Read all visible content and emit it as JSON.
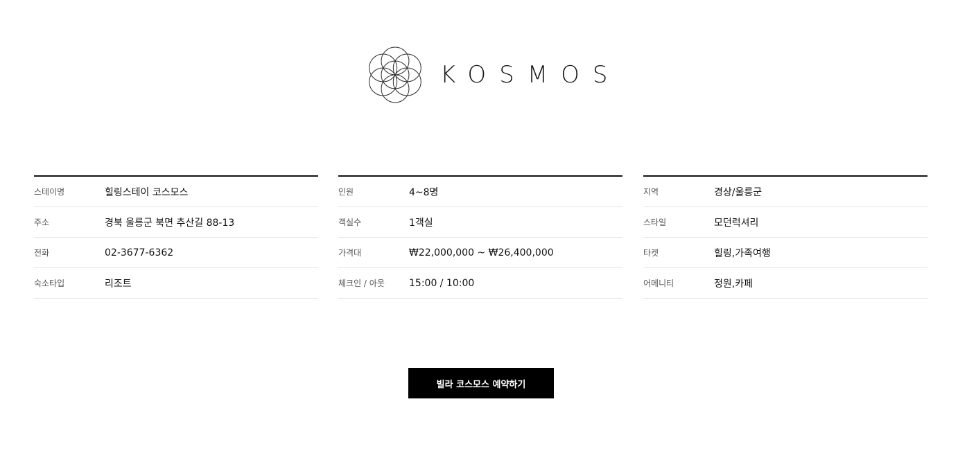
{
  "brand": {
    "logo_icon": "flower-of-life-icon",
    "name": "KOSMOS"
  },
  "info_columns": [
    {
      "rows": [
        {
          "label": "스테이명",
          "value": "힐링스테이 코스모스"
        },
        {
          "label": "주소",
          "value": "경북 울릉군 북면 추산길 88-13"
        },
        {
          "label": "전화",
          "value": "02-3677-6362"
        },
        {
          "label": "숙소타입",
          "value": "리조트"
        }
      ]
    },
    {
      "rows": [
        {
          "label": "인원",
          "value": "4~8명"
        },
        {
          "label": "객실수",
          "value": "1객실"
        },
        {
          "label": "가격대",
          "value": "₩22,000,000 ~ ₩26,400,000"
        },
        {
          "label": "체크인 / 아웃",
          "value": "15:00 / 10:00"
        }
      ]
    },
    {
      "rows": [
        {
          "label": "지역",
          "value": "경상/울릉군"
        },
        {
          "label": "스타일",
          "value": "모던럭셔리"
        },
        {
          "label": "타켓",
          "value": "힐링,가족여행"
        },
        {
          "label": "어메니티",
          "value": "정원,카페"
        }
      ]
    }
  ],
  "reserve_button": {
    "label": "빌라 코스모스 예약하기"
  },
  "colors": {
    "text": "#111111",
    "label": "#555555",
    "divider": "#e4e4e4",
    "button_bg": "#000000",
    "button_text": "#ffffff"
  }
}
